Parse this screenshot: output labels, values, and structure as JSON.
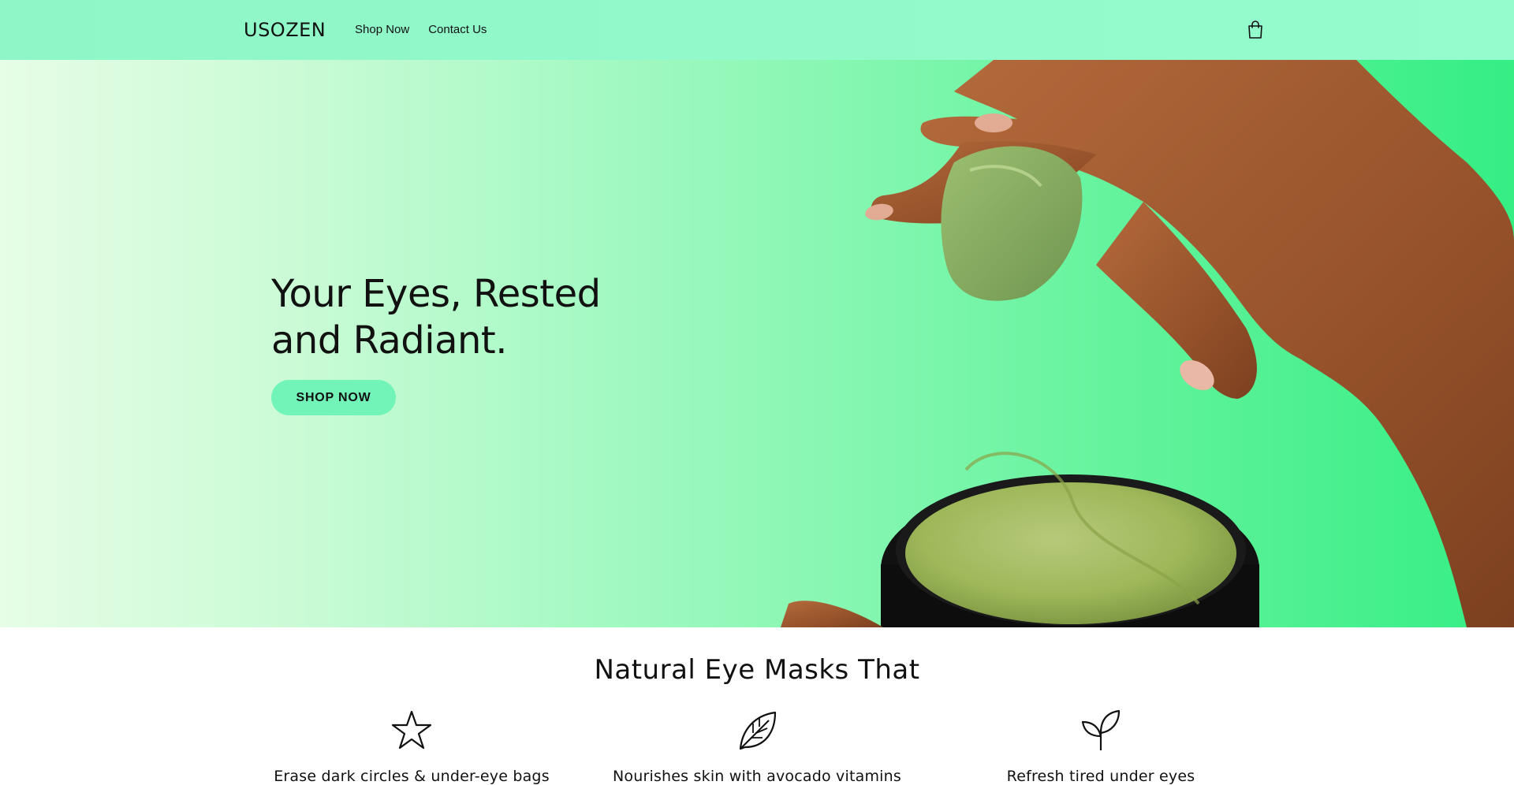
{
  "header": {
    "logo": "USOZEN",
    "nav": [
      {
        "label": "Shop Now"
      },
      {
        "label": "Contact Us"
      }
    ],
    "cart_icon": "shopping-bag-icon"
  },
  "hero": {
    "title_line1": "Your Eyes, Rested",
    "title_line2": "and Radiant.",
    "button_label": "SHOP NOW",
    "image": "hand-holding-green-eye-patch-over-jar"
  },
  "features": {
    "title": "Natural Eye Masks That",
    "items": [
      {
        "icon": "star-icon",
        "text": "Erase dark circles & under-eye bags"
      },
      {
        "icon": "leaf-icon",
        "text": "Nourishes skin with avocado vitamins"
      },
      {
        "icon": "sprout-icon",
        "text": "Refresh tired under eyes"
      }
    ]
  },
  "colors": {
    "header_bg": "#95fccd",
    "hero_gradient_start": "#e6fde6",
    "hero_gradient_end": "#35ee84",
    "button_bg": "#72f4b8",
    "text": "#111111"
  }
}
